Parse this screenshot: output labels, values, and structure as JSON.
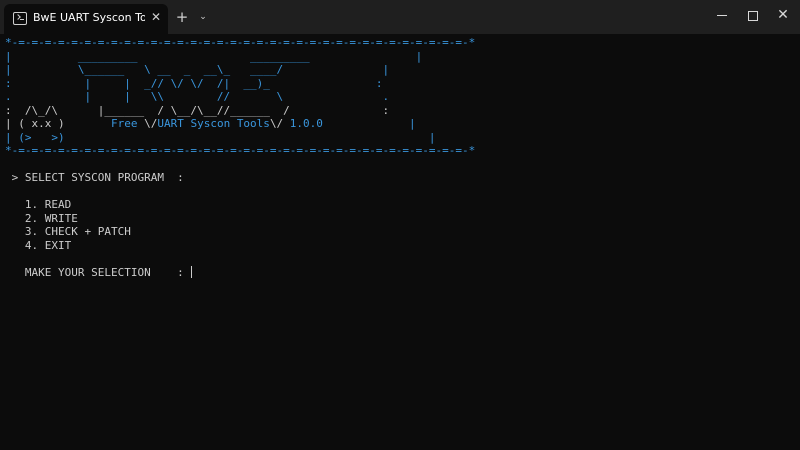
{
  "window": {
    "tab_title": "BwE UART Syscon Tools (Free",
    "tab_icon": "terminal-icon",
    "close_tab_glyph": "✕",
    "new_tab_glyph": "+",
    "dropdown_glyph": "⌄",
    "minimize_glyph": "",
    "close_glyph": "✕"
  },
  "banner": {
    "border_top": "*-=-=-=-=-=-=-=-=-=-=-=-=-=-=-=-=-=-=-=-=-=-=-=-=-=-=-=-=-=-=-=-=-=-=-*",
    "line1": "|          _________                 _________                |",
    "line2": "|          \\______   \\ __  _  __\\_   ____/               |",
    "line3": ":           |     |  _// \\/ \\/  /|  __)_                :",
    "line4": ".           |     |   \\\\        //       \\               .",
    "line5_left": ":  /\\_/\\      |______  / \\__/\\__//______  /              :",
    "line6_left": "| ( x.x )       ",
    "line6_free": "Free ",
    "line6_sep1": "\\/",
    "line6_title": "UART Syscon Tools",
    "line6_sep2": "\\/",
    "line6_version": " 1.0.0",
    "line6_right": "             |",
    "line7": "| (>   >)                                                       |",
    "border_bottom": "*-=-=-=-=-=-=-=-=-=-=-=-=-=-=-=-=-=-=-=-=-=-=-=-=-=-=-=-=-=-=-=-=-=-=-*"
  },
  "menu": {
    "heading": " > SELECT SYSCON PROGRAM  :",
    "options": [
      "   1. READ",
      "   2. WRITE",
      "   3. CHECK + PATCH",
      "   4. EXIT"
    ],
    "prompt": "   MAKE YOUR SELECTION    : "
  },
  "colors": {
    "background": "#0c0c0c",
    "text": "#cccccc",
    "accent": "#3a96dd",
    "titlebar": "#1f1f1f"
  }
}
